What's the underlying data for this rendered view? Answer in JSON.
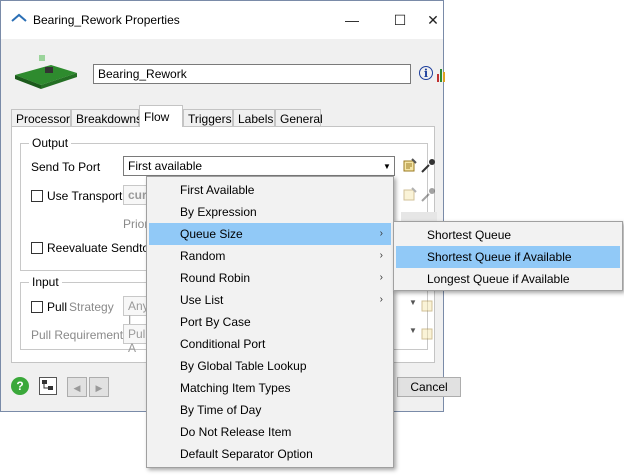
{
  "window": {
    "title": "Bearing_Rework  Properties",
    "object_name": "Bearing_Rework",
    "controls": {
      "minimize": "—",
      "maximize": "☐",
      "close": "✕"
    }
  },
  "tabs": [
    {
      "label": "Processor",
      "active": false
    },
    {
      "label": "Breakdowns",
      "active": false
    },
    {
      "label": "Flow",
      "active": true
    },
    {
      "label": "Triggers",
      "active": false
    },
    {
      "label": "Labels",
      "active": false
    },
    {
      "label": "General",
      "active": false
    }
  ],
  "output": {
    "group_label": "Output",
    "send_to_port_label": "Send To Port",
    "send_to_port_value": "First available",
    "use_transport_label": "Use Transport",
    "use_transport_value": "curr",
    "priority_label": "Priori",
    "reevaluate_label": "Reevaluate Sendto o"
  },
  "input": {
    "group_label": "Input",
    "pull_label": "Pull",
    "strategy_label": "Strategy",
    "strategy_value": "Any I",
    "pull_requirement_label": "Pull Requirement",
    "pull_requirement_value": "Pull A"
  },
  "buttons": {
    "cancel": "Cancel",
    "help_icon": "?"
  },
  "menu": {
    "items": [
      {
        "label": "First Available",
        "has_submenu": false,
        "highlighted": false
      },
      {
        "label": "By Expression",
        "has_submenu": false,
        "highlighted": false
      },
      {
        "label": "Queue Size",
        "has_submenu": true,
        "highlighted": true
      },
      {
        "label": "Random",
        "has_submenu": true,
        "highlighted": false
      },
      {
        "label": "Round Robin",
        "has_submenu": true,
        "highlighted": false
      },
      {
        "label": "Use List",
        "has_submenu": true,
        "highlighted": false
      },
      {
        "label": "Port By Case",
        "has_submenu": false,
        "highlighted": false
      },
      {
        "label": "Conditional Port",
        "has_submenu": false,
        "highlighted": false
      },
      {
        "label": "By Global Table Lookup",
        "has_submenu": false,
        "highlighted": false
      },
      {
        "label": "Matching Item Types",
        "has_submenu": false,
        "highlighted": false
      },
      {
        "label": "By Time of Day",
        "has_submenu": false,
        "highlighted": false
      },
      {
        "label": "Do Not Release Item",
        "has_submenu": false,
        "highlighted": false
      },
      {
        "label": "Default Separator Option",
        "has_submenu": false,
        "highlighted": false
      }
    ],
    "submenu_arrow": "›"
  },
  "submenu": {
    "items": [
      {
        "label": "Shortest Queue",
        "highlighted": false
      },
      {
        "label": "Shortest Queue if Available",
        "highlighted": true
      },
      {
        "label": "Longest Queue if Available",
        "highlighted": false
      }
    ]
  },
  "colors": {
    "highlight": "#91c9f7",
    "menu_bg": "#f2f2f2",
    "window_bg": "#f0f0f0"
  }
}
